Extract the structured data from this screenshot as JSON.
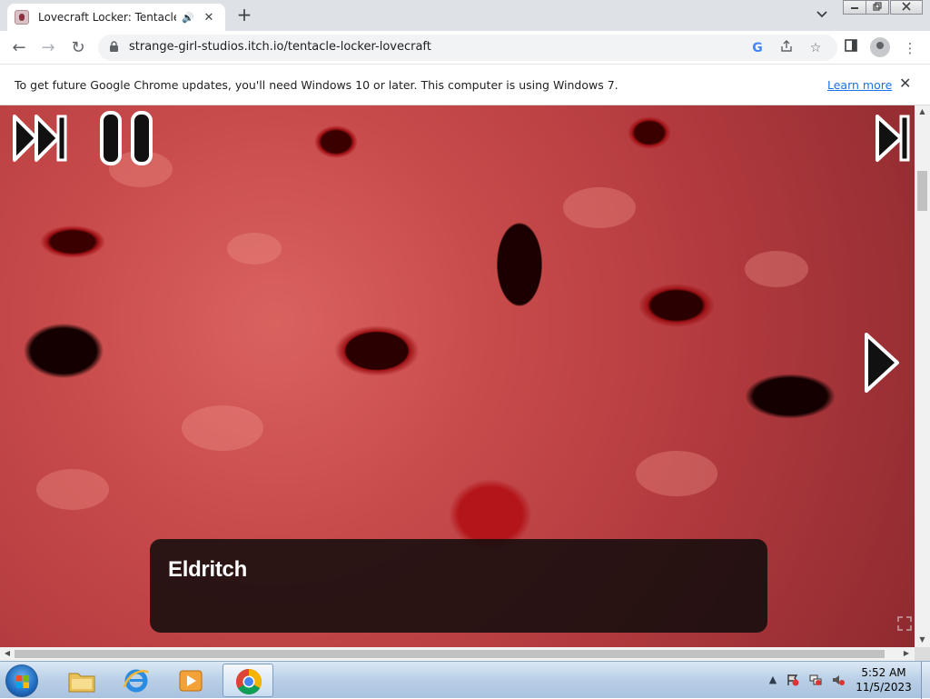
{
  "browser": {
    "tab": {
      "title": "Lovecraft Locker: Tentacle Lo",
      "audio_icon": "speaker-icon",
      "close": "✕"
    },
    "new_tab": "+",
    "tab_search": "⌄",
    "window_controls": {
      "minimize": "▭",
      "restore": "❐",
      "close": "✕"
    },
    "url": "strange-girl-studios.itch.io/tentacle-locker-lovecraft",
    "nav": {
      "back": "←",
      "forward": "→",
      "reload": "↻"
    }
  },
  "infobar": {
    "message": "To get future Google Chrome updates, you'll need Windows 10 or later. This computer is using Windows 7.",
    "link": "Learn more",
    "close": "✕"
  },
  "game": {
    "controls": [
      "skip-icon",
      "pause-icon",
      "skip-to-end-icon",
      "next-arrow-icon"
    ],
    "dialog": {
      "speaker": "Eldritch",
      "text": ""
    }
  },
  "taskbar": {
    "apps": [
      "file-explorer",
      "internet-explorer",
      "media-player",
      "chrome"
    ],
    "clock": {
      "time": "5:52 AM",
      "date": "11/5/2023"
    }
  },
  "colors": {
    "tab_bar": "#dee1e6",
    "link": "#1a73e8",
    "game_bg": "#c84b4b"
  }
}
